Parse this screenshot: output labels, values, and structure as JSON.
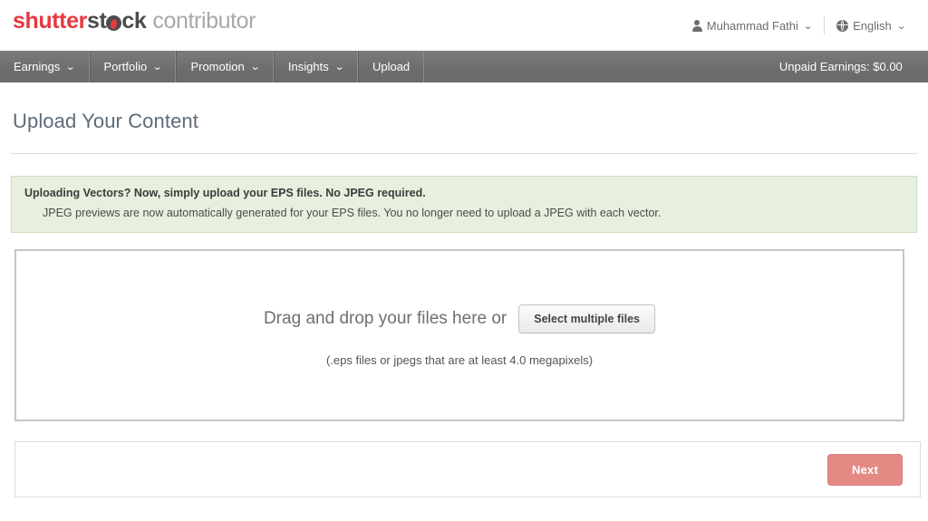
{
  "header": {
    "logo": {
      "brand_part1": "shutter",
      "brand_part2": "st",
      "brand_part3": "ck",
      "product": "contributor",
      "brand_red": "#e6393f",
      "brand_dark": "#4c4c4c",
      "product_gray": "#a8a8a8"
    },
    "account": {
      "icon": "person-icon",
      "name": "Muhammad Fathi",
      "caret": "⌄"
    },
    "language": {
      "icon": "globe-icon",
      "name": "English",
      "caret": "⌄"
    }
  },
  "nav": {
    "items": [
      {
        "label": "Earnings",
        "has_caret": true,
        "caret": "⌄"
      },
      {
        "label": "Portfolio",
        "has_caret": true,
        "caret": "⌄"
      },
      {
        "label": "Promotion",
        "has_caret": true,
        "caret": "⌄"
      },
      {
        "label": "Insights",
        "has_caret": true,
        "caret": "⌄"
      },
      {
        "label": "Upload",
        "has_caret": false,
        "caret": ""
      }
    ],
    "unpaid_earnings": {
      "label": "Unpaid Earnings: $0.00",
      "caret": "⌄"
    },
    "bg_color": "#6e6e6e"
  },
  "page": {
    "title": "Upload Your Content"
  },
  "notice": {
    "heading": "Uploading Vectors? Now, simply upload your EPS files. No JPEG required.",
    "body": "JPEG previews are now automatically generated for your EPS files. You no longer need to upload a JPEG with each vector.",
    "bg_color": "#e7f0de",
    "border_color": "#cfe0c0"
  },
  "dropzone": {
    "prompt": "Drag and drop your files here or",
    "button_label": "Select multiple files",
    "hint": "(.eps files or jpegs that are at least 4.0 megapixels)"
  },
  "footer": {
    "next_label": "Next",
    "next_color": "#e38a85"
  }
}
